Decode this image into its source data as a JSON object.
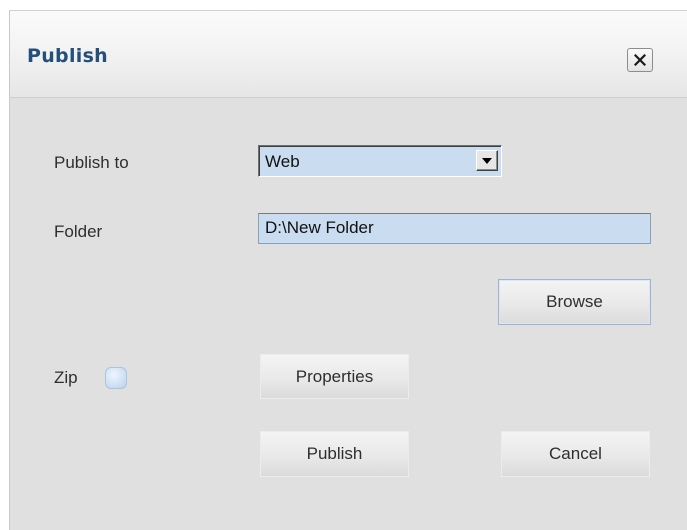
{
  "dialog": {
    "title": "Publish",
    "close_icon": "close-x-icon"
  },
  "form": {
    "publish_to_label": "Publish to",
    "publish_to_value": "Web",
    "dropdown_icon": "chevron-down-icon",
    "folder_label": "Folder",
    "folder_value": "D:\\New Folder",
    "zip_label": "Zip",
    "zip_checked": false
  },
  "buttons": {
    "browse": "Browse",
    "properties": "Properties",
    "publish": "Publish",
    "cancel": "Cancel"
  },
  "colors": {
    "title": "#234f7a",
    "field_background": "#c9dcf0",
    "dialog_background": "#e0e0e0"
  }
}
